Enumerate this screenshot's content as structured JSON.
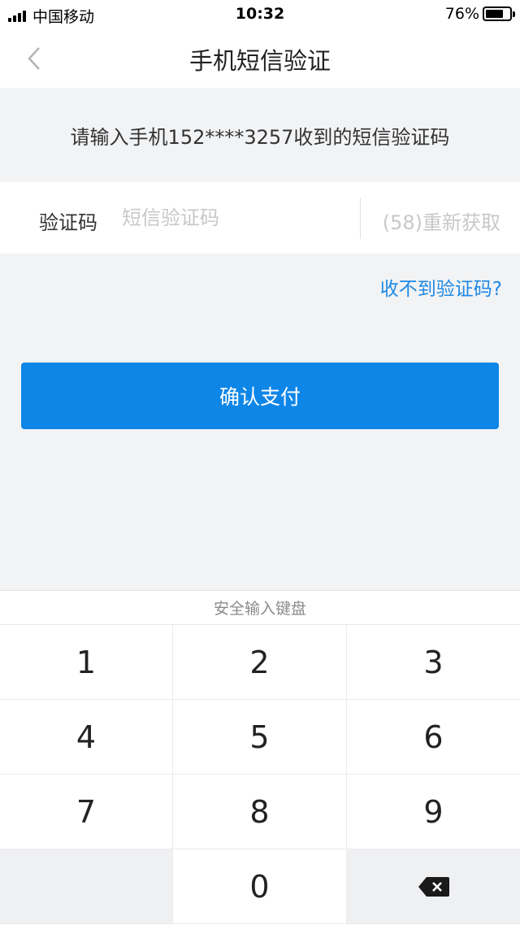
{
  "status_bar": {
    "carrier": "中国移动",
    "time": "10:32",
    "battery_percent": "76%",
    "battery_level": 0.76
  },
  "nav": {
    "title": "手机短信验证",
    "back_icon": "chevron-left-icon"
  },
  "prompt": {
    "text": "请输入手机152****3257收到的短信验证码"
  },
  "code_field": {
    "label": "验证码",
    "placeholder": "短信验证码",
    "value": "",
    "resend_label": "(58)重新获取"
  },
  "no_code_link": "收不到验证码?",
  "confirm_button": "确认支付",
  "keyboard": {
    "title": "安全输入键盘",
    "keys": [
      "1",
      "2",
      "3",
      "4",
      "5",
      "6",
      "7",
      "8",
      "9",
      "",
      "0"
    ],
    "delete_icon": "backspace-icon"
  },
  "colors": {
    "accent": "#0e86e8",
    "link": "#1e88e5",
    "background": "#f2f3f5"
  }
}
